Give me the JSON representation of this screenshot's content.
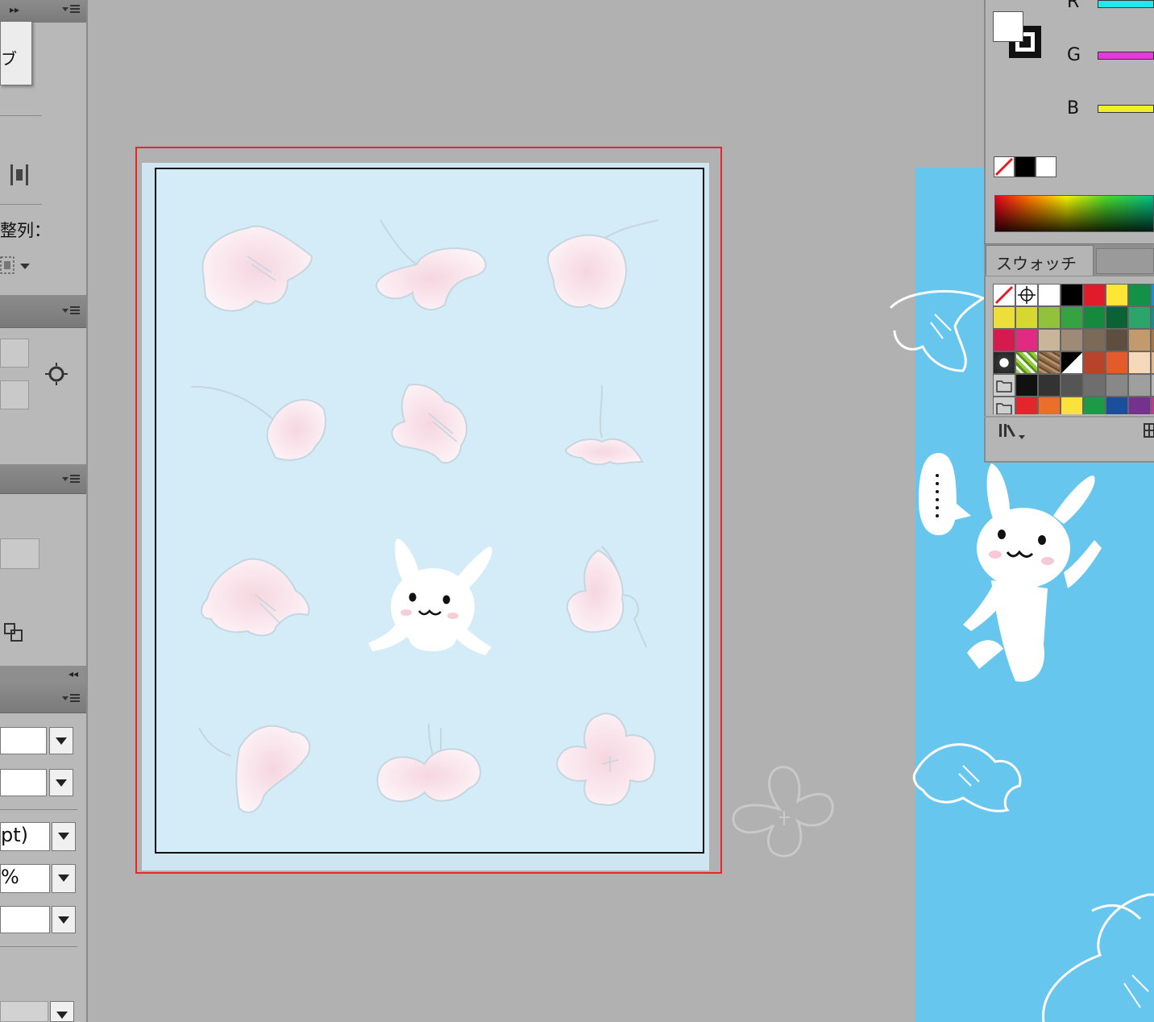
{
  "left_dock": {
    "top_panel_partial_label": "ブ",
    "align_label": "整列：",
    "stroke_field_value": "pt)",
    "percent_field_value": "%"
  },
  "color_panel": {
    "channels": [
      {
        "label": "R",
        "color": "#22e8ee"
      },
      {
        "label": "G",
        "color": "#e838dc"
      },
      {
        "label": "B",
        "color": "#f2ee2a"
      }
    ]
  },
  "swatches_panel": {
    "tab_label": "スウォッチ",
    "rows": [
      [
        "none",
        "registration",
        "#ffffff",
        "#000000",
        "#e21b2b",
        "#fde635",
        "#129246",
        "#1a8fd4"
      ],
      [
        "#ecdf3a",
        "#d6d72f",
        "#92c13c",
        "#36a343",
        "#158a3d",
        "#0b6335",
        "#2ca56a",
        "#1a8d8f"
      ],
      [
        "#d71a4d",
        "#e12b83",
        "#c8b59a",
        "#9e8b77",
        "#7b6a57",
        "#5e4e3f",
        "#c39a6c",
        "#a4764a"
      ],
      [
        "pattern-1",
        "pattern-2",
        "pattern-3",
        "pattern-4",
        "#b9422a",
        "#e45a2b",
        "#f6d8ba",
        "#e2b98d"
      ],
      [
        "folder",
        "#111111",
        "#333333",
        "#555555",
        "#6e6e6e",
        "#888888",
        "#9f9f9f",
        "#b5b5b5"
      ],
      [
        "folder",
        "#e3262c",
        "#ec6e2b",
        "#fbe13b",
        "#1c9a48",
        "#1b4f9c",
        "#74328d",
        "#b93e8b"
      ]
    ]
  },
  "colors": {
    "canvas": "#b1b1b1",
    "artboard": "#d3ecf8",
    "selection": "#e8252b",
    "background_art": "#67c6ee"
  }
}
